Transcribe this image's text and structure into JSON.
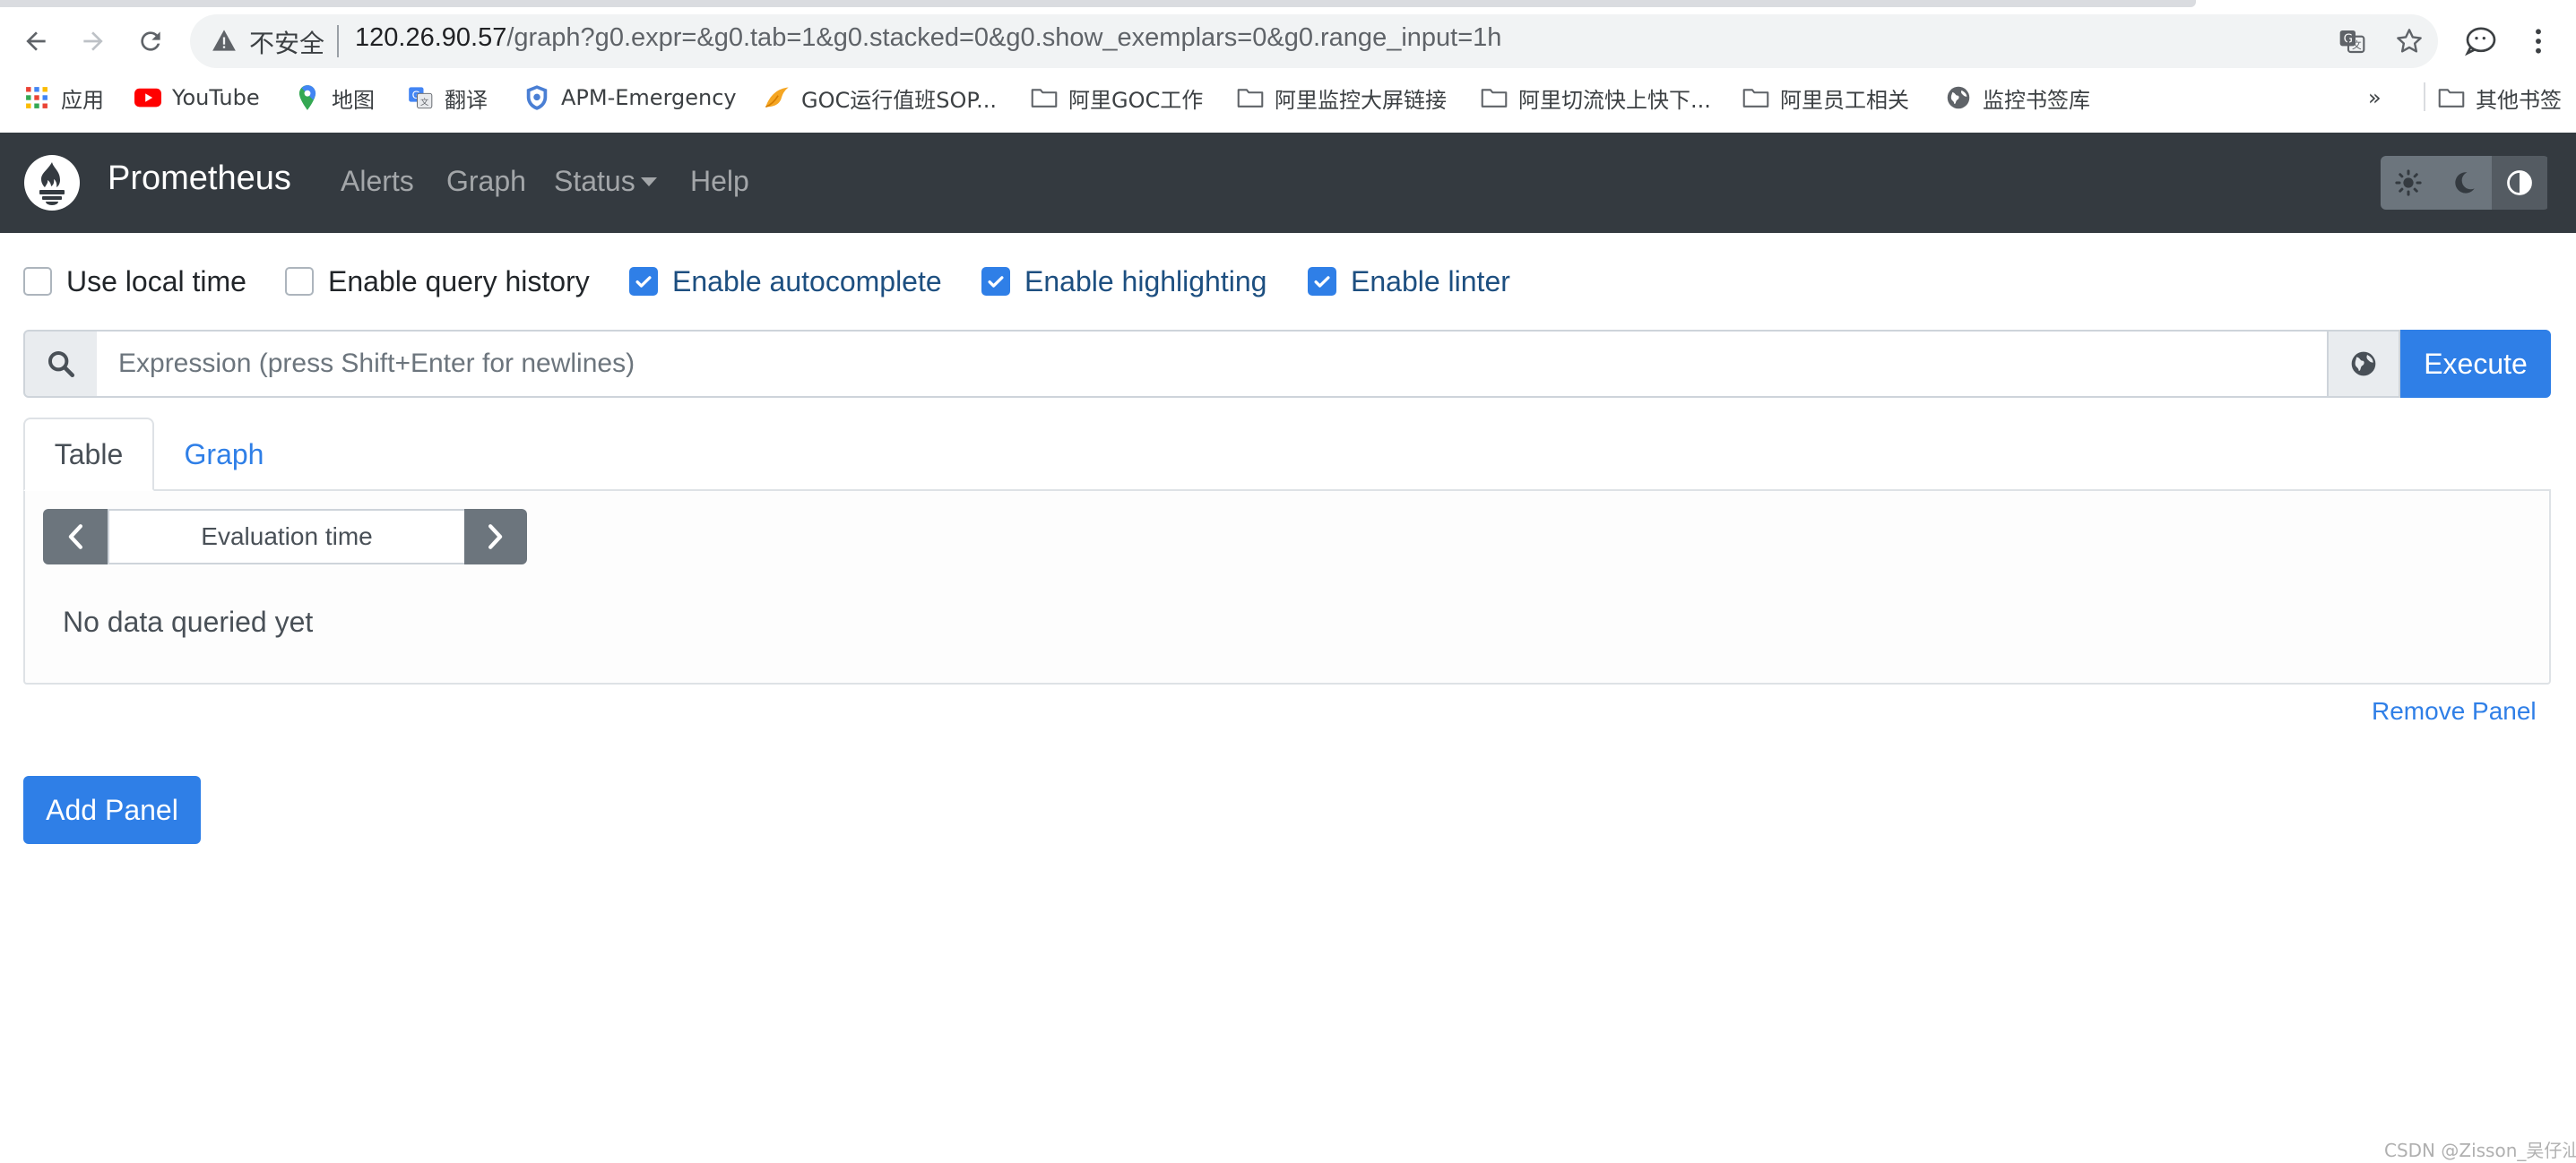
{
  "browser": {
    "insecure_label": "不安全",
    "url_host": "120.26.90.57",
    "url_path": "/graph?g0.expr=&g0.tab=1&g0.stacked=0&g0.show_exemplars=0&g0.range_input=1h",
    "bookmarks": [
      {
        "label": "应用",
        "icon": "apps-grid-icon"
      },
      {
        "label": "YouTube",
        "icon": "youtube-icon"
      },
      {
        "label": "地图",
        "icon": "maps-pin-icon"
      },
      {
        "label": "翻译",
        "icon": "translate-icon"
      },
      {
        "label": "APM-Emergency",
        "icon": "shield-icon"
      },
      {
        "label": "GOC运行值班SOP...",
        "icon": "bird-icon"
      },
      {
        "label": "阿里GOC工作",
        "icon": "folder-icon"
      },
      {
        "label": "阿里监控大屏链接",
        "icon": "folder-icon"
      },
      {
        "label": "阿里切流快上快下...",
        "icon": "folder-icon"
      },
      {
        "label": "阿里员工相关",
        "icon": "folder-icon"
      },
      {
        "label": "监控书签库",
        "icon": "globe-icon"
      }
    ],
    "more_label": "»",
    "other_bookmarks": "其他书签"
  },
  "navbar": {
    "brand": "Prometheus",
    "links": [
      "Alerts",
      "Graph",
      "Status",
      "Help"
    ],
    "theme_buttons": [
      "light-theme-icon",
      "dark-theme-icon",
      "auto-theme-icon"
    ]
  },
  "options": [
    {
      "label": "Use local time",
      "checked": false
    },
    {
      "label": "Enable query history",
      "checked": false
    },
    {
      "label": "Enable autocomplete",
      "checked": true
    },
    {
      "label": "Enable highlighting",
      "checked": true
    },
    {
      "label": "Enable linter",
      "checked": true
    }
  ],
  "expression": {
    "placeholder": "Expression (press Shift+Enter for newlines)",
    "value": "",
    "execute_label": "Execute"
  },
  "panel": {
    "tabs": [
      "Table",
      "Graph"
    ],
    "active_tab": "Table",
    "eval_time_placeholder": "Evaluation time",
    "no_data": "No data queried yet",
    "remove_label": "Remove Panel"
  },
  "add_panel_label": "Add Panel",
  "watermark": "CSDN @Zisson_吴仔汕",
  "colors": {
    "navbar_bg": "#343a40",
    "primary": "#2f7fe7",
    "secondary": "#6c757d"
  }
}
